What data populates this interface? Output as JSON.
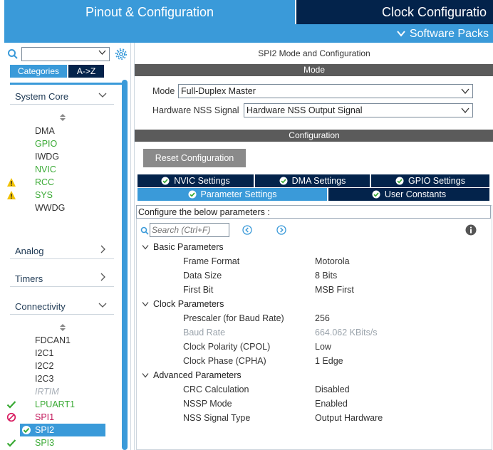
{
  "top_tabs": {
    "pinout": "Pinout & Configuration",
    "clock": "Clock Configuratio"
  },
  "subbar": {
    "software_packs": "Software Packs"
  },
  "left": {
    "tabs": {
      "categories": "Categories",
      "az": "A->Z"
    },
    "groups": [
      {
        "label": "System Core",
        "expanded": true
      },
      {
        "label": "Analog",
        "expanded": false
      },
      {
        "label": "Timers",
        "expanded": false
      },
      {
        "label": "Connectivity",
        "expanded": true
      }
    ],
    "system_core_items": [
      {
        "label": "DMA",
        "status": "normal"
      },
      {
        "label": "GPIO",
        "status": "green"
      },
      {
        "label": "IWDG",
        "status": "normal"
      },
      {
        "label": "NVIC",
        "status": "green"
      },
      {
        "label": "RCC",
        "status": "warning"
      },
      {
        "label": "SYS",
        "status": "warning"
      },
      {
        "label": "WWDG",
        "status": "normal"
      }
    ],
    "connectivity_items": [
      {
        "label": "FDCAN1",
        "status": "normal"
      },
      {
        "label": "I2C1",
        "status": "normal"
      },
      {
        "label": "I2C2",
        "status": "normal"
      },
      {
        "label": "I2C3",
        "status": "normal"
      },
      {
        "label": "IRTIM",
        "status": "disabled"
      },
      {
        "label": "LPUART1",
        "status": "ok"
      },
      {
        "label": "SPI1",
        "status": "error"
      },
      {
        "label": "SPI2",
        "status": "selected"
      },
      {
        "label": "SPI3",
        "status": "ok"
      }
    ]
  },
  "right": {
    "title": "SPI2 Mode and Configuration",
    "mode_bar": "Mode",
    "mode_label": "Mode",
    "mode_value": "Full-Duplex Master",
    "nss_label": "Hardware NSS Signal",
    "nss_value": "Hardware NSS Output Signal",
    "config_bar": "Configuration",
    "reset_button": "Reset Configuration",
    "tabs": {
      "nvic": "NVIC Settings",
      "dma": "DMA Settings",
      "gpio": "GPIO Settings",
      "params": "Parameter Settings",
      "user": "User Constants"
    },
    "hint": "Configure the below parameters :",
    "search_placeholder": "Search (Ctrl+F)",
    "categories": {
      "basic": "Basic Parameters",
      "clock": "Clock Parameters",
      "advanced": "Advanced Parameters"
    },
    "params": {
      "frame_format": {
        "name": "Frame Format",
        "value": "Motorola"
      },
      "data_size": {
        "name": "Data Size",
        "value": "8 Bits"
      },
      "first_bit": {
        "name": "First Bit",
        "value": "MSB First"
      },
      "prescaler": {
        "name": "Prescaler (for Baud Rate)",
        "value": "256"
      },
      "baud_rate": {
        "name": "Baud Rate",
        "value": "664.062 KBits/s"
      },
      "cpol": {
        "name": "Clock Polarity (CPOL)",
        "value": "Low"
      },
      "cpha": {
        "name": "Clock Phase (CPHA)",
        "value": "1 Edge"
      },
      "crc": {
        "name": "CRC Calculation",
        "value": "Disabled"
      },
      "nssp": {
        "name": "NSSP Mode",
        "value": "Enabled"
      },
      "nss_type": {
        "name": "NSS Signal Type",
        "value": "Output Hardware"
      }
    }
  },
  "colors": {
    "accent": "#3a9ad9",
    "navy": "#03234b",
    "green": "#3aaa35",
    "warning": "#f2c200",
    "error": "#d81b60"
  }
}
